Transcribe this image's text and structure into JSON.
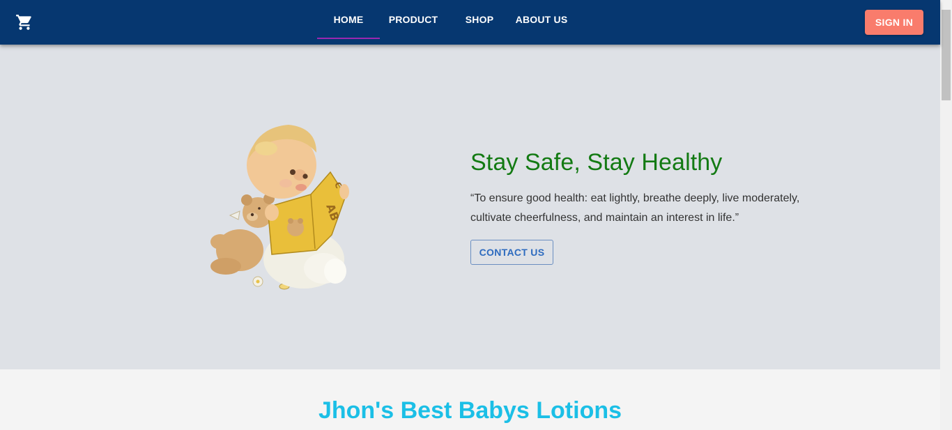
{
  "nav": {
    "cart_icon": "shopping-cart-icon",
    "tabs": [
      {
        "label": "HOME",
        "active": true
      },
      {
        "label": "PRODUCT",
        "active": false
      },
      {
        "label": "SHOP",
        "active": false
      },
      {
        "label": "ABOUT US",
        "active": false
      }
    ],
    "signin_label": "SIGN IN"
  },
  "hero": {
    "illustration": "baby-reading-with-teddy-bear",
    "title": "Stay Safe, Stay Healthy",
    "quote": "“To ensure good health: eat lightly, breathe deeply, live moderately, cultivate cheerfulness, and maintain an interest in life.”",
    "contact_label": "CONTACT US"
  },
  "section": {
    "title": "Jhon's Best Babys Lotions"
  },
  "colors": {
    "appbar": "#063770",
    "signin": "#f97c6c",
    "hero_bg": "#dee1e6",
    "hero_title": "#137a13",
    "section_title": "#1bbfe6",
    "tab_indicator": "#9c27b0"
  }
}
